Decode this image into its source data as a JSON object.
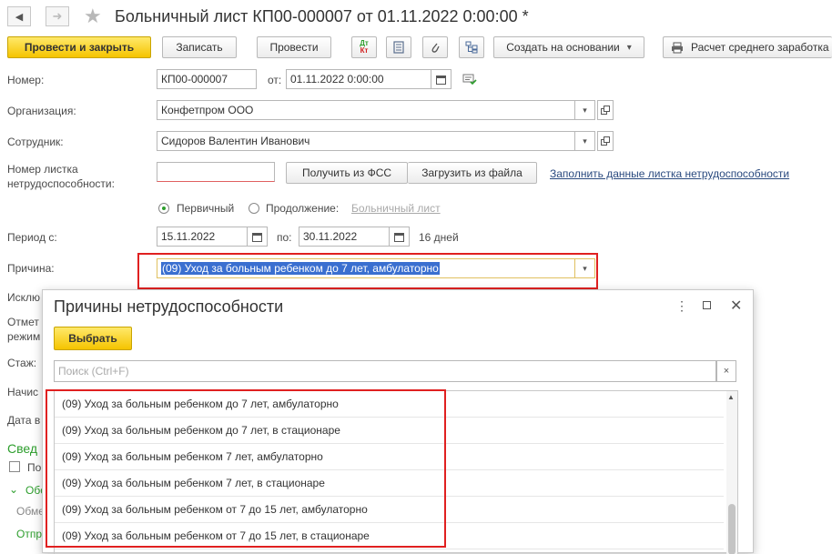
{
  "window": {
    "title": "Больничный лист КП00-000007 от 01.11.2022 0:00:00 *"
  },
  "nav": {
    "back": "◀",
    "forward": "➜",
    "star": "★"
  },
  "toolbar": {
    "post_close": "Провести и закрыть",
    "save": "Записать",
    "post": "Провести",
    "dtkt_top": "Дт",
    "dtkt_bottom": "Кт",
    "create_based": "Создать на основании",
    "create_caret": "▾",
    "print_avg": "Расчет среднего заработка"
  },
  "form": {
    "number_label": "Номер:",
    "number_value": "КП00-000007",
    "from_label": "от:",
    "from_value": "01.11.2022  0:00:00",
    "org_label": "Организация:",
    "org_value": "Конфетпром ООО",
    "employee_label": "Сотрудник:",
    "employee_value": "Сидоров Валентин Иванович",
    "sheet_label_line1": "Номер листка",
    "sheet_label_line2": "нетрудоспособности:",
    "sheet_value": "",
    "get_fss": "Получить из ФСС",
    "load_file": "Загрузить из файла",
    "fill_link": "Заполнить данные листка нетрудоспособности",
    "primary_label": "Первичный",
    "continue_label": "Продолжение:",
    "sick_link": "Больничный лист",
    "period_label": "Период с:",
    "period_from": "15.11.2022",
    "period_to_label": "по:",
    "period_to": "30.11.2022",
    "days": "16 дней",
    "reason_label": "Причина:",
    "reason_value": "(09) Уход за больным ребенком до 7 лет, амбулаторно",
    "partial_labels": [
      "Исклю",
      "Отмет",
      "режим",
      "Стаж:",
      "Начис",
      "Дата в",
      "Свед",
      "По",
      "Обо",
      "Обме",
      "Отпр"
    ]
  },
  "dialog": {
    "title": "Причины нетрудоспособности",
    "select": "Выбрать",
    "search_placeholder": "Поиск (Ctrl+F)",
    "items": [
      "(09) Уход за больным ребенком до 7 лет, амбулаторно",
      "(09) Уход за больным ребенком до 7 лет, в стационаре",
      "(09) Уход за больным ребенком 7 лет, амбулаторно",
      "(09) Уход за больным ребенком 7 лет, в стационаре",
      "(09) Уход за больным ребенком от 7 до 15 лет, амбулаторно",
      "(09) Уход за больным ребенком от 7 до 15 лет, в стационаре"
    ]
  },
  "colors": {
    "accent_yellow": "#f5c400",
    "highlight_red": "#e02020",
    "link_blue": "#2a4a7f",
    "green": "#2d9e2d",
    "selection_blue": "#3a6fd0"
  }
}
